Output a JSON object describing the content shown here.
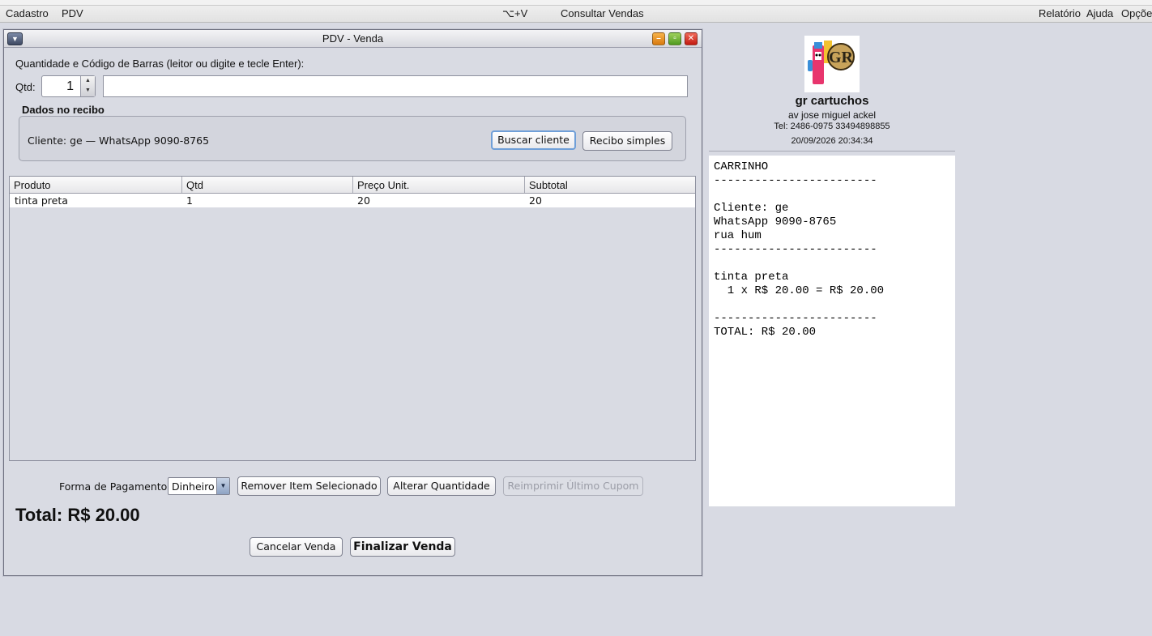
{
  "menubar": {
    "left": [
      "Cadastro",
      "PDV"
    ],
    "shortcut": "⌥+V",
    "center": "Consultar Vendas",
    "right": [
      "Relatório",
      "Ajuda",
      "Opções"
    ]
  },
  "window": {
    "title": "PDV - Venda"
  },
  "input": {
    "instruction": "Quantidade e Código de Barras (leitor ou digite e tecle Enter):",
    "qtd_label": "Qtd:",
    "qtd_value": "1",
    "barcode_value": ""
  },
  "recibo": {
    "title": "Dados no recibo",
    "cliente_text": "Cliente: ge — WhatsApp 9090-8765",
    "buscar_label": "Buscar cliente",
    "simples_label": "Recibo simples"
  },
  "table": {
    "columns": [
      "Produto",
      "Qtd",
      "Preço Unit.",
      "Subtotal"
    ],
    "rows": [
      [
        "tinta preta",
        "1",
        "20",
        "20"
      ]
    ]
  },
  "footer": {
    "pay_label": "Forma de Pagamento:",
    "pay_value": "Dinheiro",
    "remove_label": "Remover Item Selecionado",
    "alter_label": "Alterar Quantidade",
    "reprint_label": "Reimprimir Último Cupom",
    "total_text": "Total: R$ 20.00",
    "cancel_label": "Cancelar Venda",
    "finalize_label": "Finalizar Venda"
  },
  "shop": {
    "name": "gr cartuchos",
    "address": "av jose miguel ackel",
    "tel": "Tel: 2486-0975  33494898855",
    "datetime": "20/09/2026 20:34:34",
    "logo_text": "GR"
  },
  "receipt_lines": [
    "CARRINHO",
    "------------------------",
    "",
    "Cliente: ge",
    "WhatsApp 9090-8765",
    "rua hum",
    "------------------------",
    "",
    "tinta preta",
    "  1 x R$ 20.00 = R$ 20.00",
    "",
    "------------------------",
    "TOTAL: R$ 20.00"
  ],
  "colors": {
    "desktop": "#d8dae3",
    "close": "#d3261a",
    "maximize": "#5aa52a",
    "minimize": "#e58a1e"
  }
}
